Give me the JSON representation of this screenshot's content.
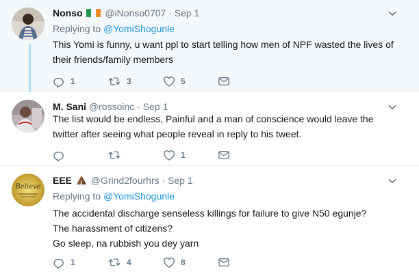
{
  "tweets": [
    {
      "name": "Nonso",
      "handle": "@iNonso0707",
      "time": "Sep 1",
      "replying_prefix": "Replying to",
      "replying_to": "@YomiShogunle",
      "lines": [
        "This Yomi is funny, u want ppl to start telling how men of NPF wasted the lives of",
        "their friends/family members"
      ],
      "replies": "1",
      "retweets": "3",
      "likes": "5"
    },
    {
      "name": "M. Sani",
      "handle": "@rossoinc",
      "time": "Sep 1",
      "lines": [
        "The list would be endless, Painful and a man of conscience would leave the",
        "twitter after seeing what people reveal in reply to his tweet."
      ],
      "replies": "",
      "retweets": "",
      "likes": "1"
    },
    {
      "name": "EEE",
      "handle": "@Grind2fourhrs",
      "time": "Sep 1",
      "replying_prefix": "Replying to",
      "replying_to": "@YomiShogunle",
      "lines": [
        "The accidental discharge senseless killings for failure to give N50 egunje?",
        "The harassment of citizens?",
        "Go sleep, na rubbish you dey yarn"
      ],
      "replies": "1",
      "retweets": "4",
      "likes": "8",
      "avatar_text": "Believe"
    }
  ],
  "separator": "·",
  "colors": {
    "accent": "#1b95e0",
    "thread_line": "#b4d9f0",
    "muted": "#657786",
    "highlight_bg": "#f5f8fa"
  },
  "icons": [
    "reply-icon",
    "retweet-icon",
    "like-icon",
    "message-icon",
    "chevron-down-icon",
    "nigeria-flag-icon",
    "praying-hands-icon"
  ]
}
